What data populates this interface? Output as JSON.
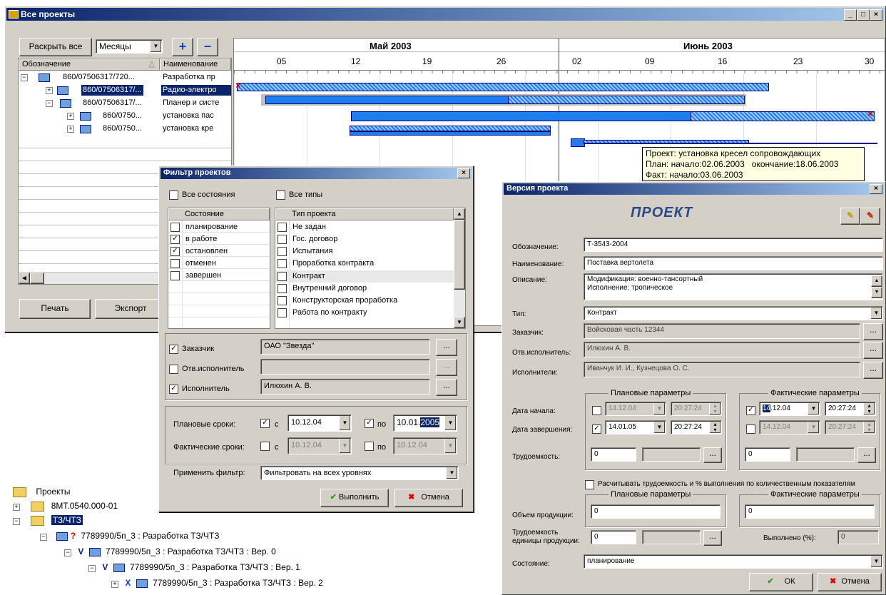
{
  "main_window": {
    "title": "Все проекты",
    "expand_all": "Раскрыть все",
    "period": "Месяцы",
    "col_designation": "Обозначение",
    "col_name": "Наименование",
    "rows": [
      {
        "designation": "860/07506317/720...",
        "name": "Разработка пр"
      },
      {
        "designation": "860/07506317/...",
        "name": "Радио-электро"
      },
      {
        "designation": "860/07506317/...",
        "name": "Планер и систе"
      },
      {
        "designation": "860/0750...",
        "name": "установка пас"
      },
      {
        "designation": "860/0750...",
        "name": "установка кре"
      }
    ],
    "print_button": "Печать",
    "export_button": "Экспорт",
    "gantt": {
      "months": [
        "Май 2003",
        "Июнь 2003"
      ],
      "days": [
        "05",
        "12",
        "19",
        "26",
        "02",
        "09",
        "16",
        "23",
        "30"
      ],
      "tooltip": {
        "line1": "Проект: установка кресел сопровождающих",
        "line2": "План: начало:02.06.2003   окончание:18.06.2003",
        "line3": "Факт: начало:03.06.2003"
      }
    }
  },
  "filter_dialog": {
    "title": "Фильтр проектов",
    "all_states": "Все состояния",
    "all_types": "Все типы",
    "state_header": "Состояние",
    "states": [
      {
        "label": "планирование",
        "checked": false
      },
      {
        "label": "в работе",
        "checked": true
      },
      {
        "label": "остановлен",
        "checked": true
      },
      {
        "label": "отменен",
        "checked": false
      },
      {
        "label": "завершен",
        "checked": false
      }
    ],
    "type_header": "Тип проекта",
    "types": [
      "Не задан",
      "Гос. договор",
      "Испытания",
      "Проработка контракта",
      "Контракт",
      "Внутренний договор",
      "Конструкторская проработка",
      "Работа по контракту"
    ],
    "customer_label": "Заказчик",
    "customer_value": "ОАО \"Звезда\"",
    "resp_label": "Отв.исполнитель",
    "resp_value": "",
    "executor_label": "Исполнитель",
    "executor_value": "Илюхин А. В.",
    "plan_terms_label": "Плановые сроки:",
    "fact_terms_label": "Фактические сроки:",
    "from_label": "с",
    "to_label": "по",
    "plan_from": "10.12.04",
    "plan_to": "10.01.",
    "plan_to_sel": "2005",
    "fact_from": "10.12.04",
    "fact_to": "10.12.04",
    "apply_label": "Применить фильтр:",
    "apply_value": "Фильтровать на всех уровнях",
    "ok_button": "Выполнить",
    "cancel_button": "Отмена"
  },
  "version_dialog": {
    "title": "Версия проекта",
    "header": "ПРОЕКТ",
    "designation_label": "Обозначение:",
    "designation": "Т-3543-2004",
    "name_label": "Наименование:",
    "name": "Поставка вертолета",
    "desc_label": "Описание:",
    "desc_line1": "Модификация: военно-тансортный",
    "desc_line2": "Исполнение: тропическое",
    "type_label": "Тип:",
    "type": "Контракт",
    "customer_label": "Заказчик:",
    "customer": "Войсковая часть 12344",
    "resp_label": "Отв.исполнитель:",
    "resp": "Илюхин А. В.",
    "executors_label": "Исполнители:",
    "executors": "Иванчук И. И., Кузнецова О. С.",
    "plan_params": "Плановые параметры",
    "fact_params": "Фактические параметры",
    "start_label": "Дата начала:",
    "end_label": "Дата завершения:",
    "labor_label": "Трудоемкость:",
    "plan_start_date": "14.12.04",
    "plan_start_time": "20:27:24",
    "plan_end_date": "14.01.05",
    "plan_end_time": "20:27:24",
    "fact_start_sel": "14",
    "fact_start_rest": ".12.04",
    "fact_start_time": "20:27:24",
    "fact_end_date": "14.12.04",
    "fact_end_time": "20:27:24",
    "plan_labor": "0",
    "fact_labor": "0",
    "calc_label": "Расчитывать трудоемкость и % выполнения по количественным показателям",
    "volume_label": "Объем продукции:",
    "plan_volume": "0",
    "fact_volume": "0",
    "unit_labor_label1": "Трудоемкость",
    "unit_labor_label2": "единицы продукции:",
    "unit_labor": "0",
    "done_label": "Выполнено (%):",
    "done": "0",
    "state_label": "Состояние:",
    "state": "планирование",
    "ok_button": "ОК",
    "cancel_button": "Отмена"
  },
  "tree": {
    "root": "Проекты",
    "item1": "8МТ.0540.000-01",
    "item2": "ТЗ/ЧТЗ",
    "sub1": "7789990/5п_3 : Разработка ТЗ/ЧТЗ",
    "sub2": "7789990/5п_3 : Разработка ТЗ/ЧТЗ : Вер. 0",
    "sub3": "7789990/5п_3 : Разработка ТЗ/ЧТЗ : Вер. 1",
    "sub4": "7789990/5п_3 : Разработка ТЗ/ЧТЗ : Вер. 2"
  }
}
